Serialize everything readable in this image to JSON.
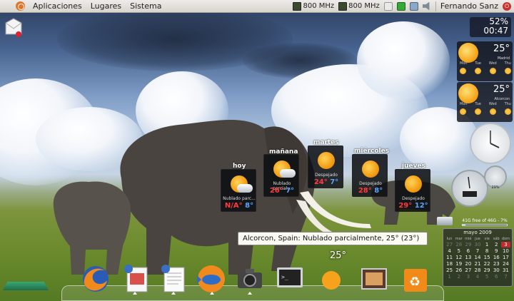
{
  "top_panel": {
    "menus": [
      "Aplicaciones",
      "Lugares",
      "Sistema"
    ],
    "cpu_freq_1": "800 MHz",
    "cpu_freq_2": "800 MHz",
    "user": "Fernando Sanz"
  },
  "forecast": [
    {
      "day": "hoy",
      "condition": "Nublado parc...",
      "high": "N/A°",
      "low": "8°",
      "icon": "partly-cloudy-icon"
    },
    {
      "day": "mañana",
      "condition": "Nublado parcial...",
      "high": "26°",
      "low": "7°",
      "icon": "partly-cloudy-icon"
    },
    {
      "day": "martes",
      "condition": "Despejado",
      "high": "24°",
      "low": "7°",
      "icon": "sun-icon"
    },
    {
      "day": "miércoles",
      "condition": "Despejado",
      "high": "28°",
      "low": "8°",
      "icon": "sun-icon"
    },
    {
      "day": "jueves",
      "condition": "Despejado",
      "high": "29°",
      "low": "12°",
      "icon": "sun-icon"
    }
  ],
  "tooltip": "Alcorcon, Spain: Nublado parcialmente, 25° (23°)",
  "dock_weather_temp": "25°",
  "battery": {
    "percent": "52%",
    "time": "00:47"
  },
  "weather_widgets": [
    {
      "temp": "25°",
      "city": "Madrid",
      "days": [
        "Mon",
        "Tue",
        "Wed",
        "Thu"
      ]
    },
    {
      "temp": "25°",
      "city": "Alcorcon",
      "days": [
        "Mon",
        "Tue",
        "Wed",
        "Thu"
      ]
    }
  ],
  "disk": {
    "label": "41G free of 46G - 7%",
    "used_fraction": 0.07
  },
  "calendar": {
    "title": "mayo 2009",
    "headers": [
      "lun",
      "mar",
      "mié",
      "jue",
      "vie",
      "sáb",
      "dom"
    ],
    "cells": [
      "27",
      "28",
      "29",
      "30",
      "1",
      "2",
      "3",
      "4",
      "5",
      "6",
      "7",
      "8",
      "9",
      "10",
      "11",
      "12",
      "13",
      "14",
      "15",
      "16",
      "17",
      "18",
      "19",
      "20",
      "21",
      "22",
      "23",
      "24",
      "25",
      "26",
      "27",
      "28",
      "29",
      "30",
      "31",
      "1",
      "2",
      "3",
      "4",
      "5",
      "6",
      "7"
    ],
    "selected": "3"
  },
  "gauge_value": "29%"
}
